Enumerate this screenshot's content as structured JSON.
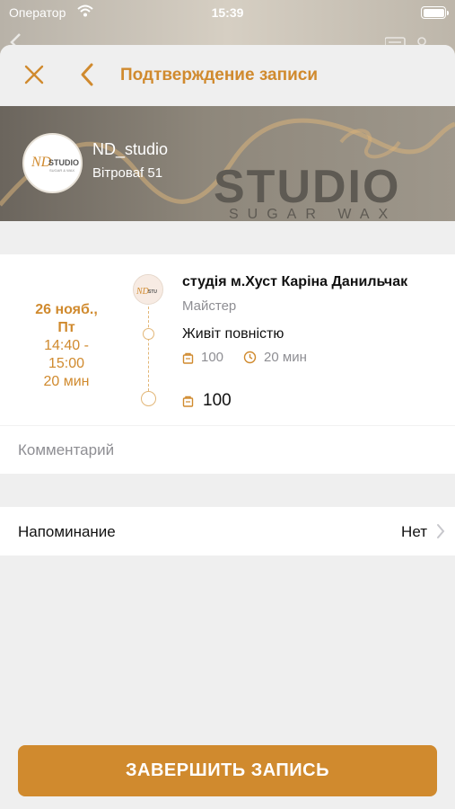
{
  "status_bar": {
    "carrier": "Оператор",
    "time": "15:39"
  },
  "nav": {
    "title": "Подтверждение записи"
  },
  "studio": {
    "name": "ND_studio",
    "address": "Вітроваf 51",
    "logo_text_main": "ND STUDIO",
    "logo_text_sub": "SUGAR & WAX",
    "hero_watermark": "STUDIO",
    "hero_watermark_sub": "SUGAR WAX"
  },
  "appointment": {
    "date": "26 нояб.,",
    "weekday": "Пт",
    "time_range_start": "14:40 -",
    "time_range_end": "15:00",
    "duration": "20 мин"
  },
  "master": {
    "name": "студія м.Хуст Каріна Данильчак",
    "role": "Майстер"
  },
  "service": {
    "name": "Живіт повністю",
    "price": "100",
    "duration": "20 мин"
  },
  "total": {
    "price": "100"
  },
  "comment": {
    "placeholder": "Комментарий"
  },
  "reminder": {
    "label": "Напоминание",
    "value": "Нет"
  },
  "submit": {
    "label": "ЗАВЕРШИТЬ ЗАПИСЬ"
  },
  "colors": {
    "accent": "#d08a2e",
    "secondary_text": "#8e8e93",
    "background": "#efefef"
  },
  "icons": [
    "wifi-icon",
    "battery-icon",
    "close-icon",
    "back-chevron-icon",
    "price-tag-icon",
    "clock-icon",
    "chevron-right-icon"
  ]
}
